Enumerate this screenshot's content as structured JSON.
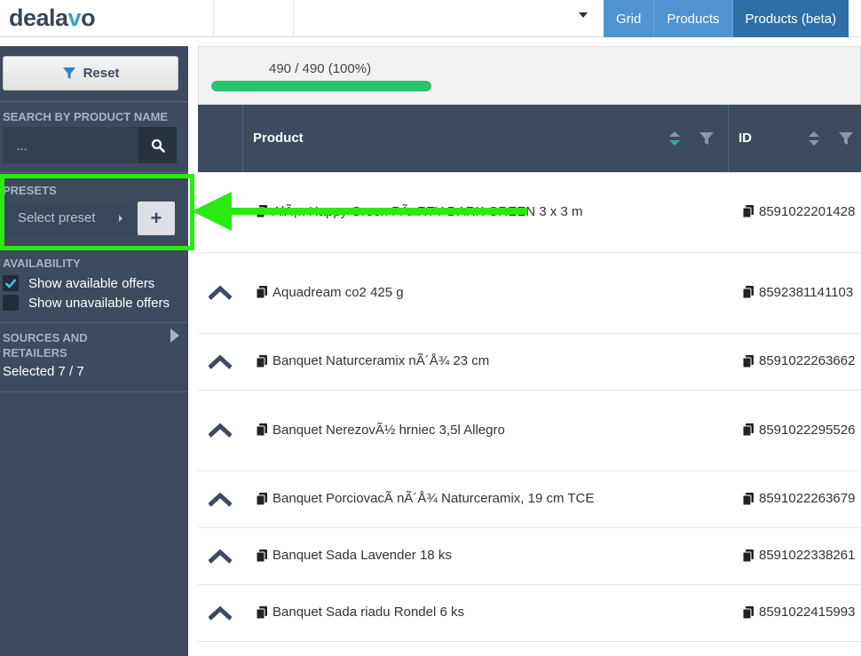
{
  "app": {
    "logo_text_a": "deala",
    "logo_text_v": "v",
    "logo_text_b": "o"
  },
  "tabs": [
    {
      "label": "Grid",
      "active": false
    },
    {
      "label": "Products",
      "active": false
    },
    {
      "label": "Products (beta)",
      "active": true
    }
  ],
  "sidebar": {
    "reset_label": "Reset",
    "search_heading": "SEARCH BY PRODUCT NAME",
    "search_placeholder": "...",
    "presets_heading": "PRESETS",
    "preset_select_label": "Select preset",
    "preset_add_label": "+",
    "availability_heading": "AVAILABILITY",
    "show_available_label": "Show available offers",
    "show_available_checked": true,
    "show_unavailable_label": "Show unavailable offers",
    "show_unavailable_checked": false,
    "sources_heading_line1": "SOURCES AND",
    "sources_heading_line2": "RETAILERS",
    "sources_selected": "Selected 7 / 7"
  },
  "progress": {
    "text": "490 / 490 (100%)",
    "fraction": 1.0,
    "color": "#27c46b"
  },
  "grid": {
    "columns": [
      {
        "label": "Product"
      },
      {
        "label": "ID"
      }
    ],
    "rows": [
      {
        "product": "AlÃ¡n Happy Green PÃ□RTY DARK GREEN 3 x 3 m",
        "id": "8591022201428",
        "expandable": false
      },
      {
        "product": "Aquadream co2 425 g",
        "id": "8592381141103",
        "expandable": true
      },
      {
        "product": "Banquet Naturceramix nÃ´Å¾ 23 cm",
        "id": "8591022263662",
        "expandable": true
      },
      {
        "product": "Banquet NerezovÃ½ hrniec 3,5l Allegro",
        "id": "8591022295526",
        "expandable": true
      },
      {
        "product": "Banquet PorciovacÃ nÃ´Å¾ Naturceramix, 19 cm TCE",
        "id": "8591022263679",
        "expandable": true
      },
      {
        "product": "Banquet Sada Lavender 18 ks",
        "id": "8591022338261",
        "expandable": true
      },
      {
        "product": "Banquet Sada riadu Rondel 6 ks",
        "id": "8591022415993",
        "expandable": true
      }
    ]
  },
  "colors": {
    "highlight": "#2aea12",
    "sidebar_bg": "#3e4b5e",
    "tab_blue": "#4f93d2",
    "tab_active": "#2f6ea8"
  },
  "icons": {
    "reset": "filter-icon",
    "search": "search-icon",
    "expand": "chevron-up-icon",
    "copy": "copy-icon",
    "sort": "sort-icon",
    "filter": "filter-icon",
    "checkbox": "check-icon",
    "sources_toggle": "caret-right-icon",
    "highlight_arrow": "arrow-left-icon"
  }
}
